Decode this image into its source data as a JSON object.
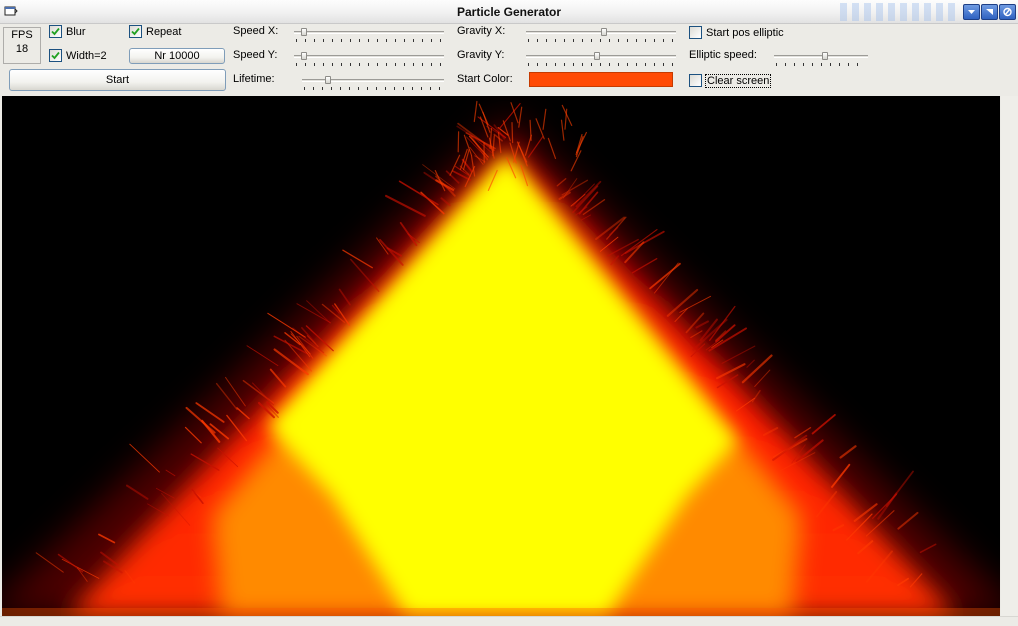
{
  "window": {
    "title": "Particle Generator",
    "icon": "window-app-icon",
    "buttons": [
      "minimize-icon",
      "maximize-icon",
      "close-icon"
    ]
  },
  "fps": {
    "label": "FPS",
    "value": "18"
  },
  "options": {
    "blur": {
      "label": "Blur",
      "checked": true
    },
    "repeat": {
      "label": "Repeat",
      "checked": true
    },
    "width": {
      "label": "Width=2",
      "checked": true
    },
    "start_pos_elliptic": {
      "label": "Start pos elliptic",
      "checked": false
    },
    "clear_screen": {
      "label": "Clear screen",
      "checked": false
    }
  },
  "buttons": {
    "nr": "Nr 10000",
    "start": "Start"
  },
  "sliders": {
    "speed_x": {
      "label": "Speed X:",
      "fraction": 0.05
    },
    "speed_y": {
      "label": "Speed Y:",
      "fraction": 0.05
    },
    "lifetime": {
      "label": "Lifetime:",
      "fraction": 0.17
    },
    "gravity_x": {
      "label": "Gravity X:",
      "fraction": 0.52
    },
    "gravity_y": {
      "label": "Gravity Y:",
      "fraction": 0.47
    },
    "elliptic_speed": {
      "label": "Elliptic speed:",
      "fraction": 0.55
    }
  },
  "start_color": {
    "label": "Start Color:",
    "value": "#ff4a04"
  },
  "render": {
    "background": "#000000",
    "core_color": "#ffff00",
    "outer_color": "#ff2a00"
  }
}
